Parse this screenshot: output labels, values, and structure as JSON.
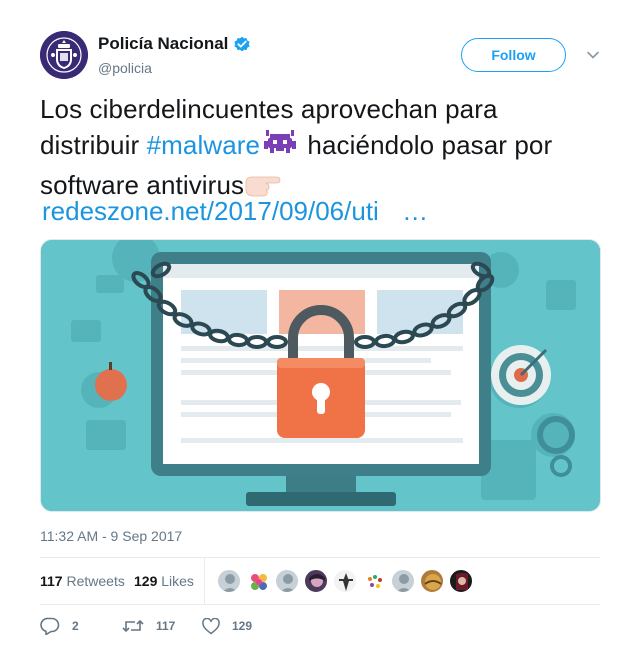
{
  "account": {
    "display_name": "Policía Nacional",
    "handle": "@policia",
    "verified": true,
    "follow_label": "Follow"
  },
  "tweet": {
    "text_part1": "Los ciberdelincuentes aprovechan  para distribuir ",
    "hashtag": "#malware",
    "text_part2": " haciéndolo pasar por software antivirus",
    "link": "redeszone.net/2017/09/06/uti",
    "link_ellipsis": "…",
    "emoji_1": "space-invader-icon",
    "emoji_2": "pointing-hand-icon"
  },
  "media": {
    "description_icon": "locked-computer-illustration"
  },
  "timestamp": "11:32 AM - 9 Sep 2017",
  "stats": {
    "retweets_count": "117",
    "retweets_label": "Retweets",
    "likes_count": "129",
    "likes_label": "Likes"
  },
  "actions": {
    "reply_count": "2",
    "retweet_count": "117",
    "like_count": "129"
  },
  "colors": {
    "accent": "#1da1f2",
    "link": "#1b95e0",
    "muted": "#657786",
    "text": "#14171a"
  }
}
